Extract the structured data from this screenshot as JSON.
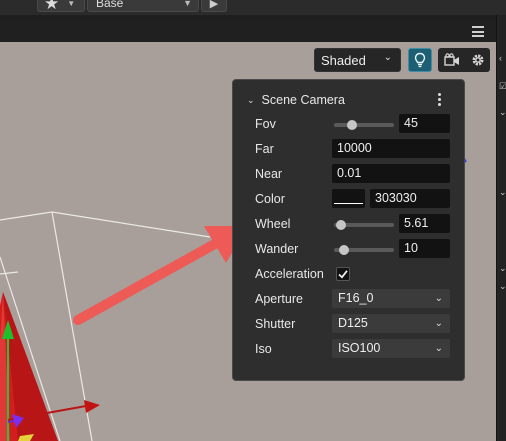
{
  "toolbar": {
    "favorite_icon": "star-icon",
    "profile_value": "Base",
    "play_icon": "play-icon"
  },
  "viewport": {
    "shading_mode": "Shaded",
    "menu_icon": "hamburger-icon",
    "light_icon": "lightbulb-icon",
    "camera_icon": "camera-icon",
    "settings_icon": "gear-icon"
  },
  "scene_camera": {
    "title": "Scene Camera",
    "fov": {
      "label": "Fov",
      "value": "45",
      "slider_fraction": 0.25
    },
    "far": {
      "label": "Far",
      "value": "10000"
    },
    "near": {
      "label": "Near",
      "value": "0.01"
    },
    "color": {
      "label": "Color",
      "value": "303030",
      "swatch_color": "#303030"
    },
    "wheel": {
      "label": "Wheel",
      "value": "5.61",
      "slider_fraction": 0.03
    },
    "wander": {
      "label": "Wander",
      "value": "10",
      "slider_fraction": 0.1
    },
    "acceleration": {
      "label": "Acceleration",
      "checked": true
    },
    "aperture": {
      "label": "Aperture",
      "value": "F16_0"
    },
    "shutter": {
      "label": "Shutter",
      "value": "D125"
    },
    "iso": {
      "label": "Iso",
      "value": "ISO100"
    }
  },
  "colors": {
    "accent": "#1f5f73",
    "annotation_arrow": "#ee5a55",
    "viewport_bg": "#a89f9b"
  }
}
